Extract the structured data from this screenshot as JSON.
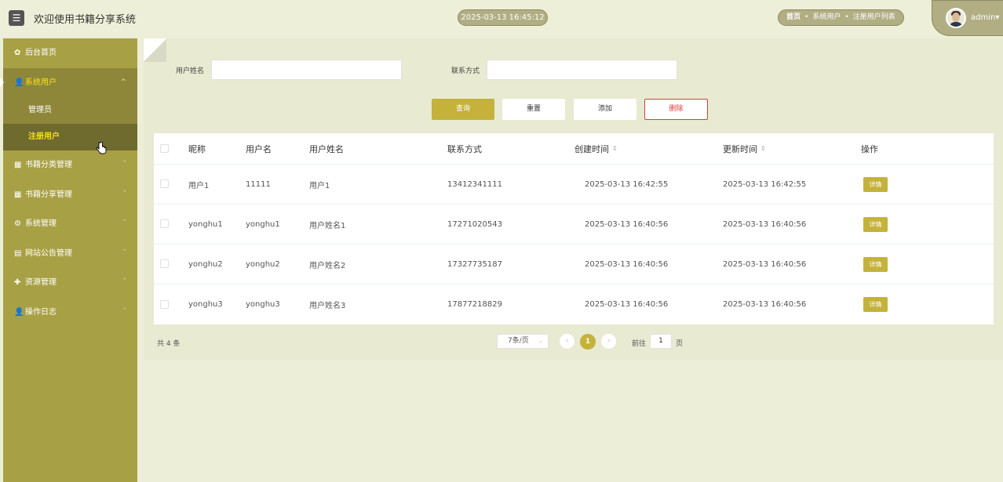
{
  "header": {
    "menu_icon": "☰",
    "title": "欢迎使用书籍分享系统",
    "datetime": "2025-03-13 16:45:12",
    "breadcrumbs": [
      "首页",
      "系统用户",
      "注册用户列表"
    ],
    "user": "admin",
    "user_caret": "▾"
  },
  "sidebar": {
    "items": [
      {
        "icon": "✿",
        "label": "后台首页",
        "chevron": ""
      },
      {
        "icon": "👤",
        "label": "系统用户",
        "chevron": "^"
      },
      {
        "icon": "▦",
        "label": "书籍分类管理",
        "chevron": "ˇ"
      },
      {
        "icon": "▦",
        "label": "书籍分享管理",
        "chevron": "ˇ"
      },
      {
        "icon": "⚙",
        "label": "系统管理",
        "chevron": "ˇ"
      },
      {
        "icon": "▤",
        "label": "网站公告管理",
        "chevron": "ˇ"
      },
      {
        "icon": "✚",
        "label": "资源管理",
        "chevron": "ˇ"
      },
      {
        "icon": "👤",
        "label": "操作日志",
        "chevron": "ˇ"
      }
    ],
    "sub_items": [
      "管理员",
      "注册用户"
    ]
  },
  "search": {
    "name_label": "用户姓名",
    "contact_label": "联系方式",
    "name_value": "",
    "contact_value": ""
  },
  "buttons": {
    "query": "查询",
    "reset": "重置",
    "add": "添加",
    "delete": "删除"
  },
  "table": {
    "columns": [
      "昵称",
      "用户名",
      "用户姓名",
      "联系方式",
      "创建时间",
      "更新时间",
      "操作"
    ],
    "sort_icon": "⇕",
    "rows": [
      {
        "nickname": "用户1",
        "username": "11111",
        "realname": "用户1",
        "contact": "13412341111",
        "created": "2025-03-13 16:42:55",
        "updated": "2025-03-13 16:42:55",
        "action": "详情"
      },
      {
        "nickname": "yonghu1",
        "username": "yonghu1",
        "realname": "用户姓名1",
        "contact": "17271020543",
        "created": "2025-03-13 16:40:56",
        "updated": "2025-03-13 16:40:56",
        "action": "详情"
      },
      {
        "nickname": "yonghu2",
        "username": "yonghu2",
        "realname": "用户姓名2",
        "contact": "17327735187",
        "created": "2025-03-13 16:40:56",
        "updated": "2025-03-13 16:40:56",
        "action": "详情"
      },
      {
        "nickname": "yonghu3",
        "username": "yonghu3",
        "realname": "用户姓名3",
        "contact": "17877218829",
        "created": "2025-03-13 16:40:56",
        "updated": "2025-03-13 16:40:56",
        "action": "详情"
      }
    ]
  },
  "pagination": {
    "total": "共 4 条",
    "page_size": "7条/页",
    "current_page": "1",
    "goto_prefix": "前往",
    "goto_value": "1",
    "goto_suffix": "页",
    "prev": "‹",
    "next": "›"
  }
}
